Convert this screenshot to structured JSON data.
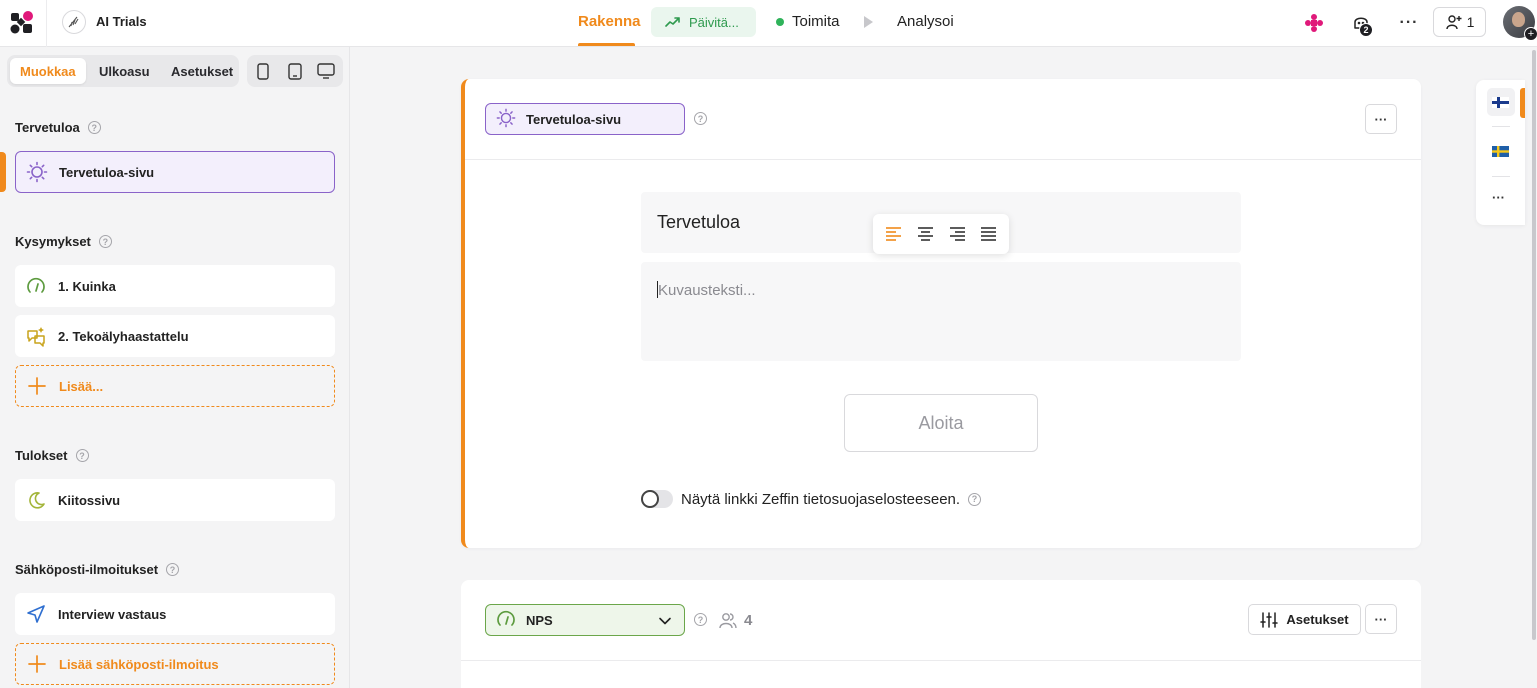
{
  "topbar": {
    "project_name": "AI Trials",
    "nav": {
      "rakenna": "Rakenna",
      "paivita": "Päivitä...",
      "toimita": "Toimita",
      "analysoi": "Analysoi"
    },
    "notifications_badge": "2",
    "collaborators_count": "1"
  },
  "sidebar": {
    "tabs": [
      "Muokkaa",
      "Ulkoasu",
      "Asetukset"
    ],
    "active_tab": "Muokkaa",
    "devices": [
      "mobile-icon",
      "tablet-icon",
      "desktop-icon"
    ],
    "sections": {
      "welcome": {
        "title": "Tervetuloa",
        "items": [
          {
            "label": "Tervetuloa-sivu",
            "icon": "sun-icon"
          }
        ]
      },
      "questions": {
        "title": "Kysymykset",
        "items": [
          {
            "label": "1. Kuinka",
            "icon": "nps-gauge-icon"
          },
          {
            "label": "2. Tekoälyhaastattelu",
            "icon": "ai-interview-icon"
          }
        ],
        "add_label": "Lisää..."
      },
      "results": {
        "title": "Tulokset",
        "items": [
          {
            "label": "Kiitossivu",
            "icon": "moon-icon"
          }
        ]
      },
      "email": {
        "title": "Sähköposti-ilmoitukset",
        "items": [
          {
            "label": "Interview vastaus",
            "icon": "send-icon"
          }
        ],
        "add_label": "Lisää sähköposti-ilmoitus"
      }
    }
  },
  "editor": {
    "page_type": "Tervetuloa-sivu",
    "title_text": "Tervetuloa",
    "description_placeholder": "Kuvausteksti...",
    "start_button": "Aloita",
    "privacy_toggle_label": "Näytä linkki Zeffin tietosuojaselosteeseen.",
    "privacy_toggle_on": false
  },
  "next_question": {
    "type": "NPS",
    "respondent_count": "4",
    "settings_label": "Asetukset"
  },
  "languages": [
    "finnish-flag",
    "swedish-flag"
  ],
  "colors": {
    "accent": "#f08a1c",
    "welcome_purple": "#8a63c9",
    "nps_green": "#6ba64a",
    "status_green": "#2fb35a"
  }
}
